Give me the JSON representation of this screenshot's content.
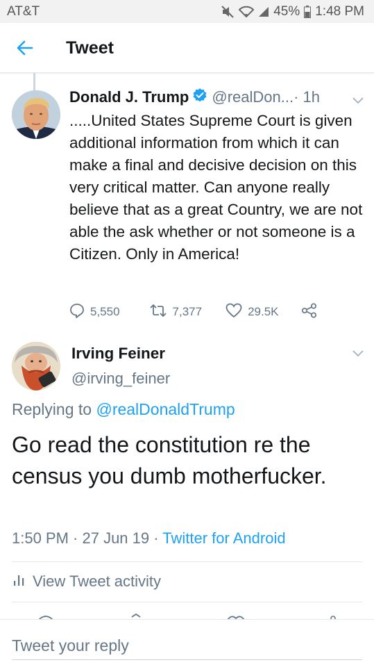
{
  "status_bar": {
    "carrier": "AT&T",
    "battery": "45%",
    "time": "1:48 PM"
  },
  "header": {
    "title": "Tweet",
    "back_icon": "arrow-left-icon"
  },
  "tweet1": {
    "name": "Donald J. Trump",
    "handle": "@realDon...",
    "time": " · 1h",
    "text": ".....United States Supreme Court is given additional information from which it can make a final and decisive decision on this very critical matter. Can anyone really believe that as a great Country, we are not able the ask whether or not someone is a Citizen. Only in America!",
    "replies": "5,550",
    "retweets": "7,377",
    "likes": "29.5K"
  },
  "tweet2": {
    "name": "Irving Feiner",
    "handle": "@irving_feiner",
    "replying_prefix": "Replying to ",
    "replying_mention": "@realDonaldTrump",
    "text": "Go read the constitution re the census you dumb motherfucker.",
    "timestamp": "1:50 PM · 27 Jun 19 · ",
    "source": "Twitter for Android",
    "activity": "View Tweet activity"
  },
  "reply_bar": {
    "placeholder": "Tweet your reply"
  },
  "colors": {
    "accent": "#1da1f2",
    "secondary_text": "#657786",
    "primary_text": "#14171a"
  }
}
